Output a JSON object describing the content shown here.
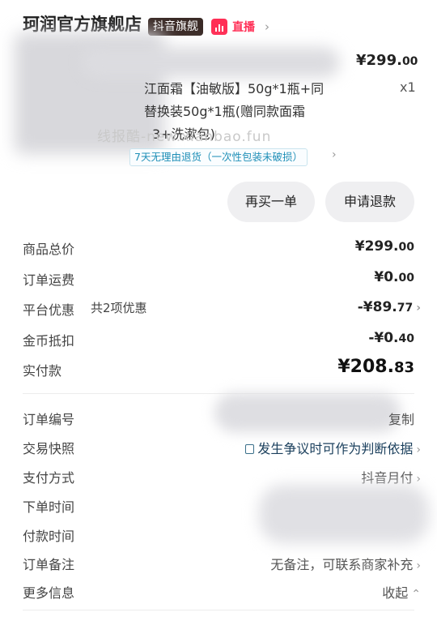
{
  "header": {
    "shop_name": "珂润官方旗舰店",
    "flag_badge": "抖音旗舰",
    "live_label": "直播",
    "arrow": "›"
  },
  "product": {
    "price_main": "¥299.",
    "price_cents": "00",
    "title_lines": [
      "江面霜【油敏版】50g*1瓶+同",
      "替换装50g*1瓶(赠同款面霜",
      "3+洗漱包)"
    ],
    "quantity": "x1",
    "watermark": "线报酷-new.xianbao.fun",
    "return_policy": "7天无理由退货（一次性包装未破损）"
  },
  "actions": {
    "rebuy": "再买一单",
    "refund": "申请退款"
  },
  "summary": {
    "goods_total": {
      "label": "商品总价",
      "main": "¥299.",
      "cents": "00"
    },
    "shipping": {
      "label": "订单运费",
      "main": "¥0.",
      "cents": "00"
    },
    "platform_discount": {
      "label": "平台优惠",
      "sub": "共2项优惠",
      "main": "-¥89.",
      "cents": "77"
    },
    "coin_deduct": {
      "label": "金币抵扣",
      "main": "-¥0.",
      "cents": "40"
    },
    "paid": {
      "label": "实付款",
      "main": "¥208.",
      "cents": "83"
    }
  },
  "details": {
    "order_no": {
      "label": "订单编号",
      "action": "复制"
    },
    "snapshot": {
      "label": "交易快照",
      "value": "发生争议时可作为判断依据"
    },
    "payment_method": {
      "label": "支付方式",
      "value": "抖音月付"
    },
    "order_time": {
      "label": "下单时间"
    },
    "pay_time": {
      "label": "付款时间"
    },
    "remark": {
      "label": "订单备注",
      "value": "无备注，可联系商家补充"
    },
    "more_info": {
      "label": "更多信息",
      "value": "收起"
    }
  },
  "colors": {
    "accent_live": "#ff2e55",
    "badge_bg": "#3a2a26",
    "return_tag": "#1f8fb7"
  }
}
